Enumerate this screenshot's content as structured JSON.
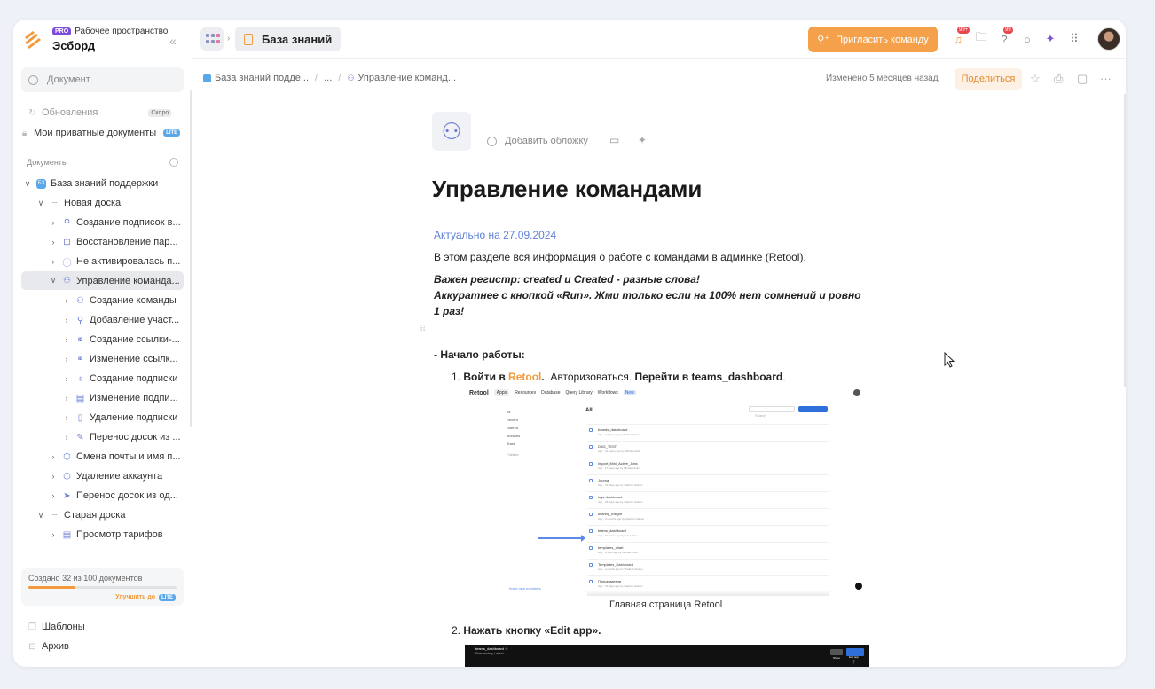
{
  "workspace": {
    "badge": "PRO",
    "label": "Рабочее пространство",
    "name": "Эсборд"
  },
  "search": {
    "placeholder": "Документ"
  },
  "sidebar": {
    "updates": "Обновления",
    "soon": "Скоро",
    "private_docs": "Мои приватные документы",
    "lite": "LITE",
    "section": "Документы",
    "tree": [
      {
        "label": "База знаний поддержки",
        "icon": "space-icon"
      },
      {
        "label": "Новая доска",
        "icon": "board-icon"
      },
      {
        "label": "Создание подписок в...",
        "icon": "user-icon"
      },
      {
        "label": "Восстановление пар...",
        "icon": "lock-icon"
      },
      {
        "label": "Не активировалась п...",
        "icon": "info-icon"
      },
      {
        "label": "Управление команда...",
        "icon": "team-icon"
      },
      {
        "label": "Создание команды",
        "icon": "team-icon"
      },
      {
        "label": "Добавление участ...",
        "icon": "user-icon"
      },
      {
        "label": "Создание ссылки-...",
        "icon": "link-icon"
      },
      {
        "label": "Изменение ссылк...",
        "icon": "link-icon"
      },
      {
        "label": "Создание подписки",
        "icon": "bulb-icon"
      },
      {
        "label": "Изменение подпи...",
        "icon": "table-icon"
      },
      {
        "label": "Удаление подписки",
        "icon": "trash-icon"
      },
      {
        "label": "Перенос досок из ...",
        "icon": "edit-icon"
      },
      {
        "label": "Смена почты и имя п...",
        "icon": "hex-icon"
      },
      {
        "label": "Удаление аккаунта",
        "icon": "hex-icon"
      },
      {
        "label": "Перенос досок из од...",
        "icon": "send-icon"
      },
      {
        "label": "Старая доска",
        "icon": "board-icon"
      },
      {
        "label": "Просмотр тарифов",
        "icon": "table-icon"
      }
    ],
    "quota": {
      "text": "Создано 32 из 100 документов",
      "fraction": 0.32,
      "upgrade": "Улучшить до"
    },
    "templates": "Шаблоны",
    "archive": "Архив"
  },
  "topbar": {
    "tab_title": "База знаний",
    "invite": "Пригласить команду",
    "notif_count": "99+",
    "help_count": "99"
  },
  "doc": {
    "breadcrumb": [
      "База знаний подде...",
      "...",
      "Управление команд..."
    ],
    "modified": "Изменено 5 месяцев назад",
    "share": "Поделиться",
    "add_cover": "Добавить обложку",
    "title": "Управление командами",
    "actual": "Актуально на 27.09.2024",
    "intro": "В этом разделе вся информация о работе с командами в админке (Retool).",
    "warn1": "Важен регистр: created и Created - разные слова!",
    "warn2": "Аккуратнее с кнопкой «Run». Жми только если на 100% нет сомнений и ровно",
    "warn3": "1 раз!",
    "start": "- Начало работы:",
    "step1": {
      "num": "1.",
      "a": "Войти в",
      "retool": "Retool",
      "b": ". Авторизоваться. ",
      "c": "Перейти в teams_dashboard",
      "d": "."
    },
    "caption": "Главная страница Retool",
    "step2": {
      "num": "2.",
      "text": "Нажать кнопку «Edit app»."
    }
  },
  "screenshot": {
    "nav": [
      "Retool",
      "Apps",
      "Resources",
      "Database",
      "Query Library",
      "Workflows",
      "New"
    ],
    "left": [
      "All",
      "Recent",
      "Starred",
      "Modules",
      "Trash",
      "Folders"
    ],
    "heading": "All",
    "search": "Search",
    "create": "Create new",
    "apps": [
      [
        "boards_dashboard",
        "App · 2 days ago by Vladimir Glazun"
      ],
      [
        "DBG_TEST",
        "App · 19 hours ago by Michael Zolin"
      ],
      [
        "Import_Mini_Active_Jobs",
        "App · 17 days ago by Michael Zolin"
      ],
      [
        "Journal",
        "App · 19 days ago by Vladimir Glazun"
      ],
      [
        "logs dashboard",
        "App · 25 days ago by Vladimir Glazun"
      ],
      [
        "sharing_insight",
        "App · 3 months ago by Vladimir Glazun"
      ],
      [
        "teams_dashboard",
        "App · 19 hours ago by Ilya Lebetu"
      ],
      [
        "templates_chart",
        "App · a year ago by Michael Zolin"
      ],
      [
        "Templates_Dashboard",
        "App · a month ago by Vladimir Glazun"
      ],
      [
        "Пользователи",
        "App · 19 days ago by Vladimir Glazun"
      ]
    ],
    "invite_members": "Invite new members",
    "bar2_title": "teams_dashboard",
    "bar2_sub": "Previewing  Latest",
    "share": "Share",
    "edit": "Edit app"
  }
}
